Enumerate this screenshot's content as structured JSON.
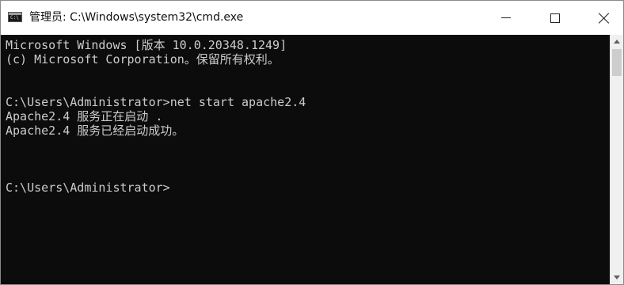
{
  "window": {
    "title": "管理员: C:\\Windows\\system32\\cmd.exe",
    "app_icon": "cmd-icon",
    "app_icon_text": "C:\\"
  },
  "controls": {
    "minimize": "minimize-icon",
    "maximize": "maximize-icon",
    "close": "close-icon"
  },
  "console": {
    "lines": [
      "Microsoft Windows [版本 10.0.20348.1249]",
      "(c) Microsoft Corporation。保留所有权利。",
      "",
      "C:\\Users\\Administrator>net start apache2.4",
      "Apache2.4 服务正在启动 .",
      "Apache2.4 服务已经启动成功。",
      "",
      "",
      "C:\\Users\\Administrator>"
    ]
  },
  "colors": {
    "console_bg": "#0c0c0c",
    "console_text": "#cccccc",
    "titlebar_bg": "#ffffff"
  }
}
